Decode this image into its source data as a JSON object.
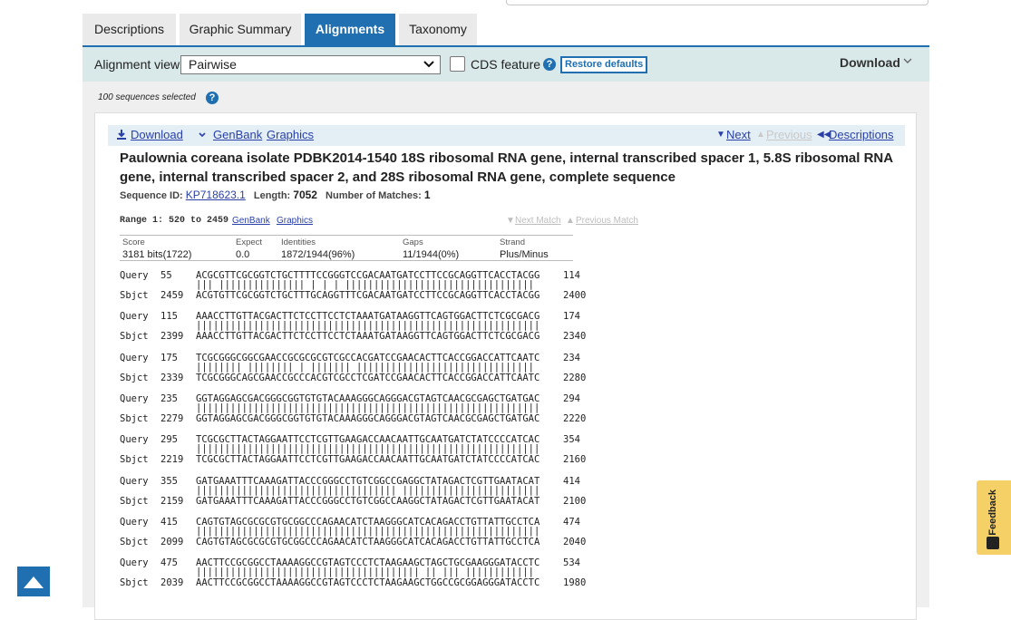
{
  "tabs": [
    "Descriptions",
    "Graphic Summary",
    "Alignments",
    "Taxonomy"
  ],
  "active_tab": "Alignments",
  "toolbar": {
    "alignment_view_label": "Alignment view",
    "alignment_view_value": "Pairwise",
    "cds_label": "CDS feature",
    "help": "?",
    "restore_label": "Restore defaults",
    "download_label": "Download"
  },
  "sequences_selected": "100 sequences selected",
  "result": {
    "download": "Download",
    "genbank": "GenBank",
    "graphics": "Graphics",
    "next": "Next",
    "previous": "Previous",
    "descriptions": "Descriptions",
    "title": "Paulownia coreana isolate PDBK2014-1540 18S ribosomal RNA gene, internal transcribed spacer 1, 5.8S ribosomal RNA gene, internal transcribed spacer 2, and 28S ribosomal RNA gene, complete sequence",
    "seq_id_label": "Sequence ID:",
    "seq_id": "KP718623.1",
    "length_label": "Length:",
    "length": "7052",
    "matches_label": "Number of Matches:",
    "matches": "1"
  },
  "range": {
    "label": "Range 1: 520 to 2459",
    "genbank": "GenBank",
    "graphics": "Graphics",
    "next_match": "Next Match",
    "previous_match": "Previous Match"
  },
  "stats": {
    "headers": [
      "Score",
      "Expect",
      "Identities",
      "Gaps",
      "Strand"
    ],
    "values": [
      "3181 bits(1722)",
      "0.0",
      "1872/1944(96%)",
      "11/1944(0%)",
      "Plus/Minus"
    ]
  },
  "alignment": [
    {
      "q_start": "55",
      "query": "ACGCGTTCGCGGTCTGCTTTTCCGGGTCCGACAATGATCCTTCCGCAGGTTCACCTACGG",
      "q_end": "114",
      "match": "||| ||||||||||||||| | | | |||||||||||||||||||||||||||||||||",
      "s_start": "2459",
      "sbjct": "ACGTGTTCGCGGTCTGCTTTGCAGGTTTCGACAATGATCCTTCCGCAGGTTCACCTACGG",
      "s_end": "2400"
    },
    {
      "q_start": "115",
      "query": "AAACCTTGTTACGACTTCTCCTTCCTCTAAATGATAAGGTTCAGTGGACTTCTCGCGACG",
      "q_end": "174",
      "match": "||||||||||||||||||||||||||||||||||||||||||||||||||||||||||||",
      "s_start": "2399",
      "sbjct": "AAACCTTGTTACGACTTCTCCTTCCTCTAAATGATAAGGTTCAGTGGACTTCTCGCGACG",
      "s_end": "2340"
    },
    {
      "q_start": "175",
      "query": "TCGCGGGCGGCGAACCGCGCGCGTCGCCACGATCCGAACACTTCACCGGACCATTCAATC",
      "q_end": "234",
      "match": "|||||||| |||||||| | ||||||| |||||||||||||||||||||||||||||||",
      "s_start": "2339",
      "sbjct": "TCGCGGGCAGCGAACCGCCCACGTCGCCTCGATCCGAACACTTCACCGGACCATTCAATC",
      "s_end": "2280"
    },
    {
      "q_start": "235",
      "query": "GGTAGGAGCGACGGGCGGTGTGTACAAAGGGCAGGGACGTAGTCAACGCGAGCTGATGAC",
      "q_end": "294",
      "match": "||||||||||||||||||||||||||||||||||||||||||||||||||||||||||||",
      "s_start": "2279",
      "sbjct": "GGTAGGAGCGACGGGCGGTGTGTACAAAGGGCAGGGACGTAGTCAACGCGAGCTGATGAC",
      "s_end": "2220"
    },
    {
      "q_start": "295",
      "query": "TCGCGCTTACTAGGAATTCCTCGTTGAAGACCAACAATTGCAATGATCTATCCCCATCAC",
      "q_end": "354",
      "match": "||||||||||||||||||||||||||||||||||||||||||||||||||||||||||||",
      "s_start": "2219",
      "sbjct": "TCGCGCTTACTAGGAATTCCTCGTTGAAGACCAACAATTGCAATGATCTATCCCCATCAC",
      "s_end": "2160"
    },
    {
      "q_start": "355",
      "query": "GATGAAATTTCAAAGATTACCCGGGCCTGTCGGCCGAGGCTATAGACTCGTTGAATACAT",
      "q_end": "414",
      "match": "||||||||||||||||||||||||||||||||||| ||||||||||||||||||||||||",
      "s_start": "2159",
      "sbjct": "GATGAAATTTCAAAGATTACCCGGGCCTGTCGGCCAAGGCTATAGACTCGTTGAATACAT",
      "s_end": "2100"
    },
    {
      "q_start": "415",
      "query": "CAGTGTAGCGCGCGTGCGGCCCAGAACATCTAAGGGCATCACAGACCTGTTATTGCCTCA",
      "q_end": "474",
      "match": "||||||||||||||||||||||||||||||||||||||||||||||||||||||||||||",
      "s_start": "2099",
      "sbjct": "CAGTGTAGCGCGCGTGCGGCCCAGAACATCTAAGGGCATCACAGACCTGTTATTGCCTCA",
      "s_end": "2040"
    },
    {
      "q_start": "475",
      "query": "AACTTCCGCGGCCTAAAAGGCCGTAGTCCCTCTAAGAAGCTAGCTGCGAAGGGATACCTC",
      "q_end": "534",
      "match": "||||||||||||||||||||||||||||||||||||||| || ||| ||||||||||||",
      "s_start": "2039",
      "sbjct": "AACTTCCGCGGCCTAAAAGGCCGTAGTCCCTCTAAGAAGCTGGCCGCGGAGGGATACCTC",
      "s_end": "1980"
    }
  ],
  "feedback_label": "Feedback",
  "colors": {
    "accent": "#1f6fb1",
    "toolbar_bg": "#d9e9ea",
    "feedback_bg": "#f5d067"
  }
}
